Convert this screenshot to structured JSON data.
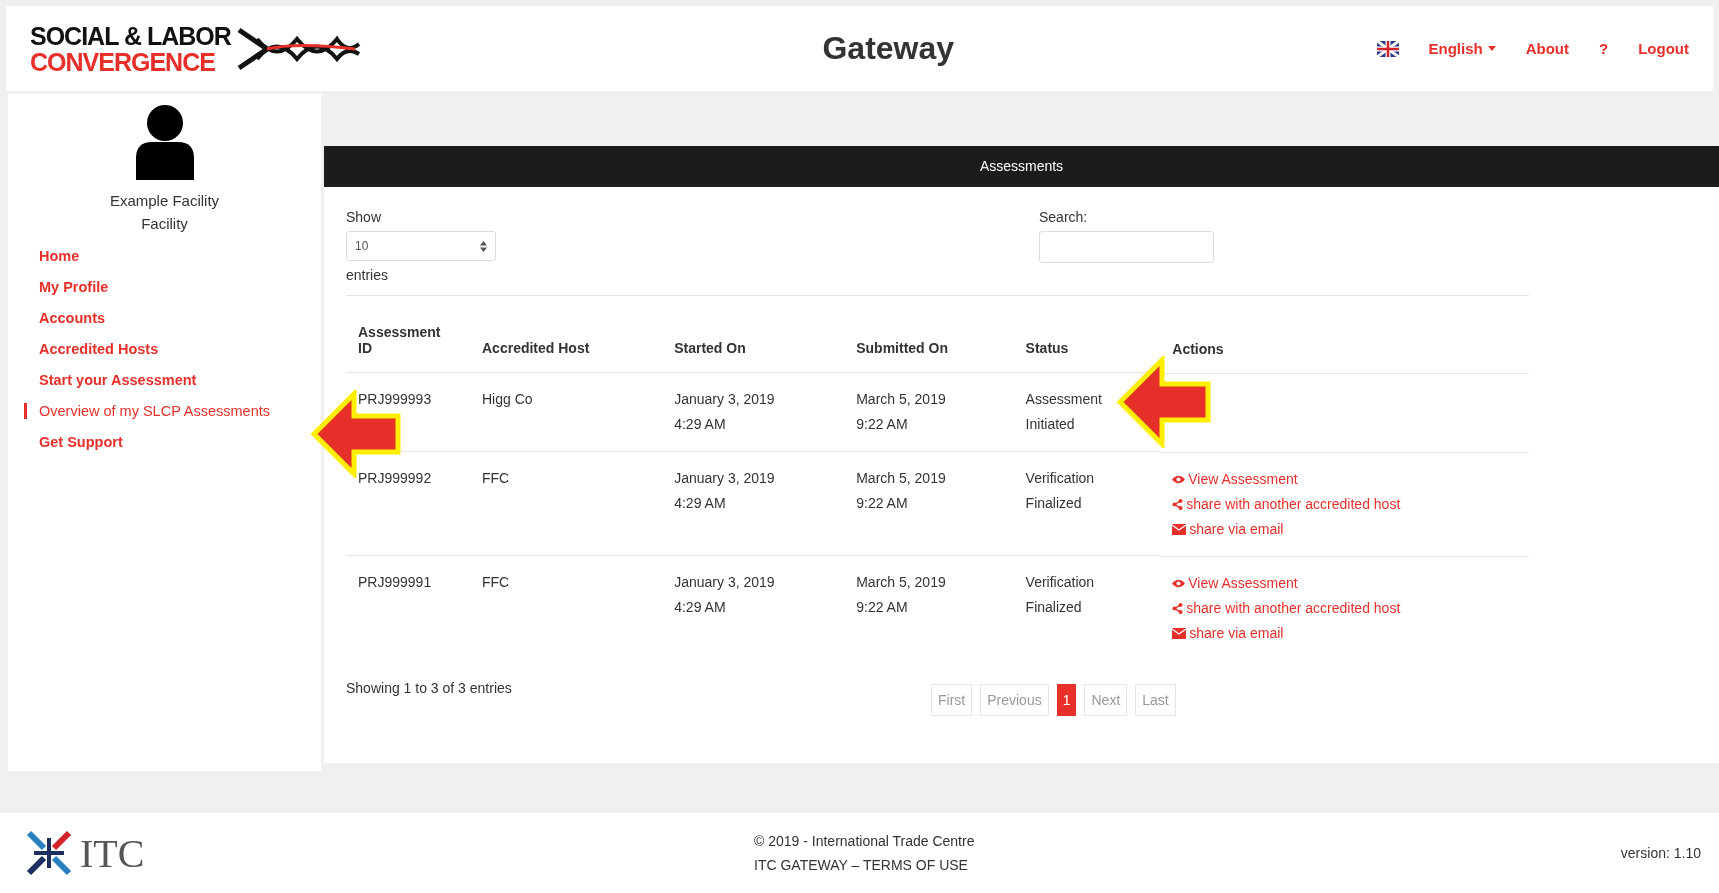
{
  "header": {
    "logo_line_1": "SOCIAL & LABOR",
    "logo_line_2": "CONVERGENCE",
    "title": "Gateway",
    "language": "English",
    "links": [
      "About",
      "?",
      "Logout"
    ]
  },
  "sidebar": {
    "user_name": "Example Facility",
    "user_role": "Facility",
    "items": [
      {
        "label": "Home",
        "selected": false
      },
      {
        "label": "My Profile",
        "selected": false
      },
      {
        "label": "Accounts",
        "selected": false
      },
      {
        "label": "Accredited Hosts",
        "selected": false
      },
      {
        "label": "Start your Assessment",
        "selected": false
      },
      {
        "label": "Overview of my SLCP Assessments",
        "selected": true
      },
      {
        "label": "Get Support",
        "selected": false
      }
    ]
  },
  "panel": {
    "title": "Assessments",
    "show_label": "Show",
    "page_size": "10",
    "entries_label": "entries",
    "search_label": "Search:"
  },
  "table": {
    "columns": [
      "Assessment ID",
      "Accredited Host",
      "Started On",
      "Submitted On",
      "Status",
      "Actions"
    ],
    "rows": [
      {
        "id": "PRJ999993",
        "host": "Higg Co",
        "started": [
          "January 3, 2019",
          "4:29 AM"
        ],
        "submitted": [
          "March 5, 2019",
          "9:22 AM"
        ],
        "status": [
          "Assessment",
          "Initiated"
        ],
        "actions": []
      },
      {
        "id": "PRJ999992",
        "host": "FFC",
        "started": [
          "January 3, 2019",
          "4:29 AM"
        ],
        "submitted": [
          "March 5, 2019",
          "9:22 AM"
        ],
        "status": [
          "Verification",
          "Finalized"
        ],
        "actions": [
          {
            "kind": "view",
            "label": "View Assessment"
          },
          {
            "kind": "share",
            "label": "share with another accredited host"
          },
          {
            "kind": "email",
            "label": "share via email"
          }
        ]
      },
      {
        "id": "PRJ999991",
        "host": "FFC",
        "started": [
          "January 3, 2019",
          "4:29 AM"
        ],
        "submitted": [
          "March 5, 2019",
          "9:22 AM"
        ],
        "status": [
          "Verification",
          "Finalized"
        ],
        "actions": [
          {
            "kind": "view",
            "label": "View Assessment"
          },
          {
            "kind": "share",
            "label": "share with another accredited host"
          },
          {
            "kind": "email",
            "label": "share via email"
          }
        ]
      }
    ]
  },
  "summary": "Showing 1 to 3 of 3 entries",
  "pagination": [
    {
      "label": "First",
      "selected": false
    },
    {
      "label": "Previous",
      "selected": false
    },
    {
      "label": "1",
      "selected": true
    },
    {
      "label": "Next",
      "selected": false
    },
    {
      "label": "Last",
      "selected": false
    }
  ],
  "footer": {
    "logo": "ITC",
    "copyright": "© 2019 - International Trade Centre",
    "terms": "ITC GATEWAY – TERMS OF USE",
    "version": "version: 1.10"
  }
}
